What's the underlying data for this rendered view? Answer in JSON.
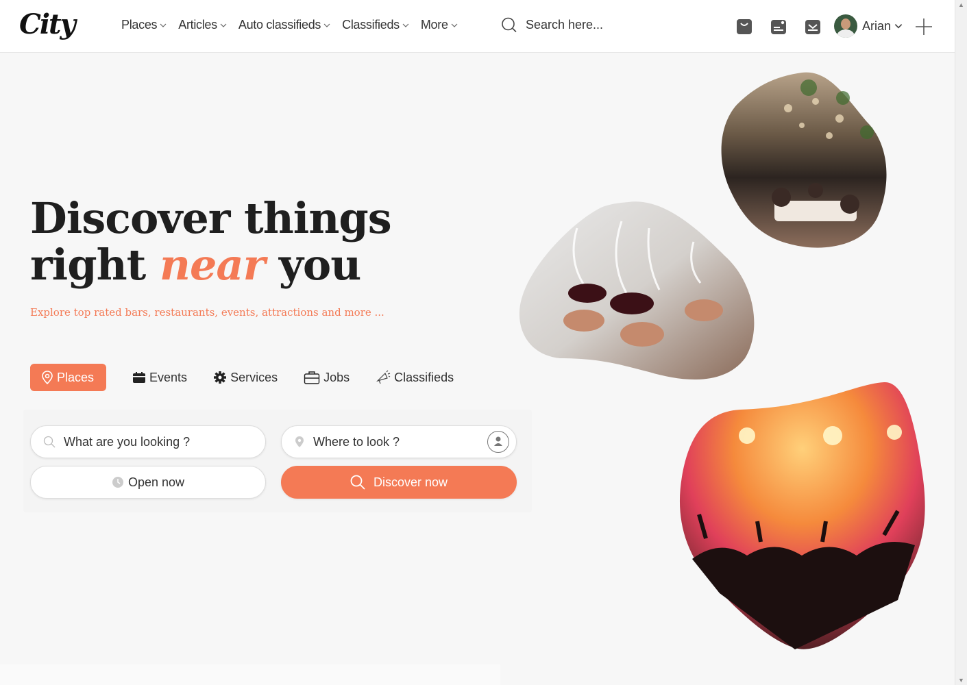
{
  "header": {
    "logo": "City",
    "nav": [
      {
        "label": "Places"
      },
      {
        "label": "Articles"
      },
      {
        "label": "Auto classifieds"
      },
      {
        "label": "Classifieds"
      },
      {
        "label": "More"
      }
    ],
    "search_placeholder": "Search here...",
    "icons": [
      "bag-icon",
      "news-icon",
      "inbox-icon"
    ],
    "user_name": "Arian"
  },
  "hero": {
    "title_line1": "Discover things",
    "title_line2_start": "right ",
    "title_highlight": "near",
    "title_line2_end": " you",
    "subtitle": "Explore top rated bars, restaurants, events, attractions and more ..."
  },
  "tabs": [
    {
      "label": "Places",
      "icon": "pin-icon",
      "active": true
    },
    {
      "label": "Events",
      "icon": "calendar-icon"
    },
    {
      "label": "Services",
      "icon": "gear-icon"
    },
    {
      "label": "Jobs",
      "icon": "briefcase-icon"
    },
    {
      "label": "Classifieds",
      "icon": "megaphone-icon"
    }
  ],
  "form": {
    "what_placeholder": "What are you looking ?",
    "where_placeholder": "Where to look ?",
    "open_now": "Open now",
    "discover": "Discover now"
  },
  "colors": {
    "accent": "#f47a55"
  }
}
